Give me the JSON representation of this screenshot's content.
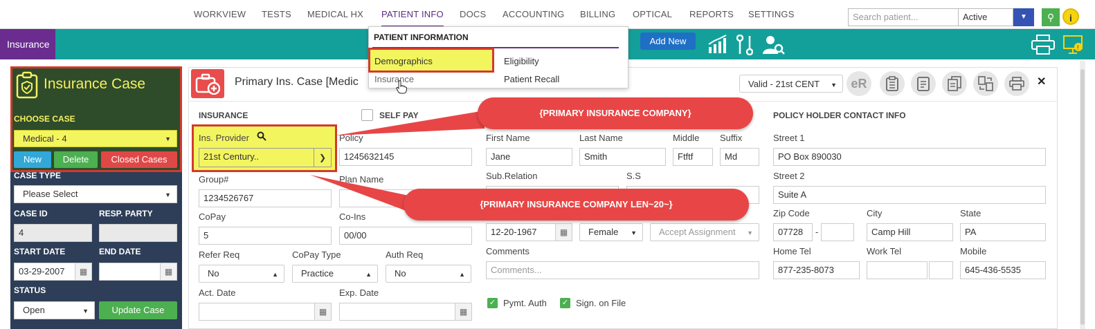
{
  "nav": {
    "items": [
      "WORKVIEW",
      "TESTS",
      "MEDICAL HX",
      "PATIENT INFO",
      "DOCS",
      "ACCOUNTING",
      "BILLING",
      "OPTICAL",
      "REPORTS",
      "SETTINGS"
    ],
    "search_placeholder": "Search patient...",
    "status_value": "Active"
  },
  "toolbar": {
    "tab_label": "Insurance",
    "add_new": "Add New"
  },
  "menu": {
    "heading": "PATIENT INFORMATION",
    "demographics": "Demographics",
    "insurance": "Insurance",
    "eligibility": "Eligibility",
    "patient_recall": "Patient Recall"
  },
  "left": {
    "title": "Insurance Case",
    "choose_case": "CHOOSE CASE",
    "case_value": "Medical - 4",
    "btn_new": "New",
    "btn_delete": "Delete",
    "btn_closed": "Closed Cases",
    "case_type_label": "CASE TYPE",
    "case_type_value": "Please Select",
    "case_id_label": "CASE ID",
    "case_id_value": "4",
    "resp_party_label": "RESP. PARTY",
    "start_date_label": "START DATE",
    "start_date_value": "03-29-2007",
    "end_date_label": "END DATE",
    "status_label": "STATUS",
    "status_value": "Open",
    "update_case": "Update Case"
  },
  "card": {
    "title": "Primary Ins. Case [Medic",
    "valid_value": "Valid - 21st CENT",
    "er_label": "eR"
  },
  "insurance": {
    "section": "INSURANCE",
    "self_pay": "SELF PAY",
    "provider_label": "Ins. Provider",
    "provider_value": "21st Century..",
    "policy_label": "Policy",
    "policy_value": "1245632145",
    "group_label": "Group#",
    "group_value": "1234526767",
    "plan_label": "Plan Name",
    "copay_label": "CoPay",
    "copay_value": "5",
    "coins_label": "Co-Ins",
    "coins_value": "00/00",
    "refer_label": "Refer Req",
    "refer_value": "No",
    "copay_type_label": "CoPay Type",
    "copay_type_value": "Practice",
    "auth_label": "Auth Req",
    "auth_value": "No",
    "act_date_label": "Act. Date",
    "exp_date_label": "Exp. Date"
  },
  "holder": {
    "first_label": "First Name",
    "first_value": "Jane",
    "last_label": "Last Name",
    "last_value": "Smith",
    "middle_label": "Middle",
    "middle_value": "Ftftf",
    "suffix_label": "Suffix",
    "suffix_value": "Md",
    "subrel_label": "Sub.Relation",
    "ss_label": "S.S",
    "dob_value": "12-20-1967",
    "gender_value": "Female",
    "accept_value": "Accept Assignment",
    "comments_label": "Comments",
    "comments_placeholder": "Comments...",
    "pymt_auth": "Pymt. Auth",
    "sign_file": "Sign. on File"
  },
  "contact": {
    "section": "POLICY HOLDER CONTACT INFO",
    "street1_label": "Street 1",
    "street1_value": "PO Box 890030",
    "street2_label": "Street 2",
    "street2_value": "Suite A",
    "zip_label": "Zip Code",
    "zip_value": "07728",
    "zip_dash": "-",
    "city_label": "City",
    "city_value": "Camp Hill",
    "state_label": "State",
    "state_value": "PA",
    "home_label": "Home Tel",
    "home_value": "877-235-8073",
    "work_label": "Work Tel",
    "mobile_label": "Mobile",
    "mobile_value": "645-436-5535"
  },
  "callouts": {
    "primary": "{PRIMARY INSURANCE COMPANY}",
    "primary_len": "{PRIMARY INSURANCE COMPANY LEN~20~}"
  },
  "colors": {
    "teal": "#14a09a",
    "purple": "#6a2d8f",
    "highlight": "#f3f55f",
    "callout": "#e84646"
  }
}
